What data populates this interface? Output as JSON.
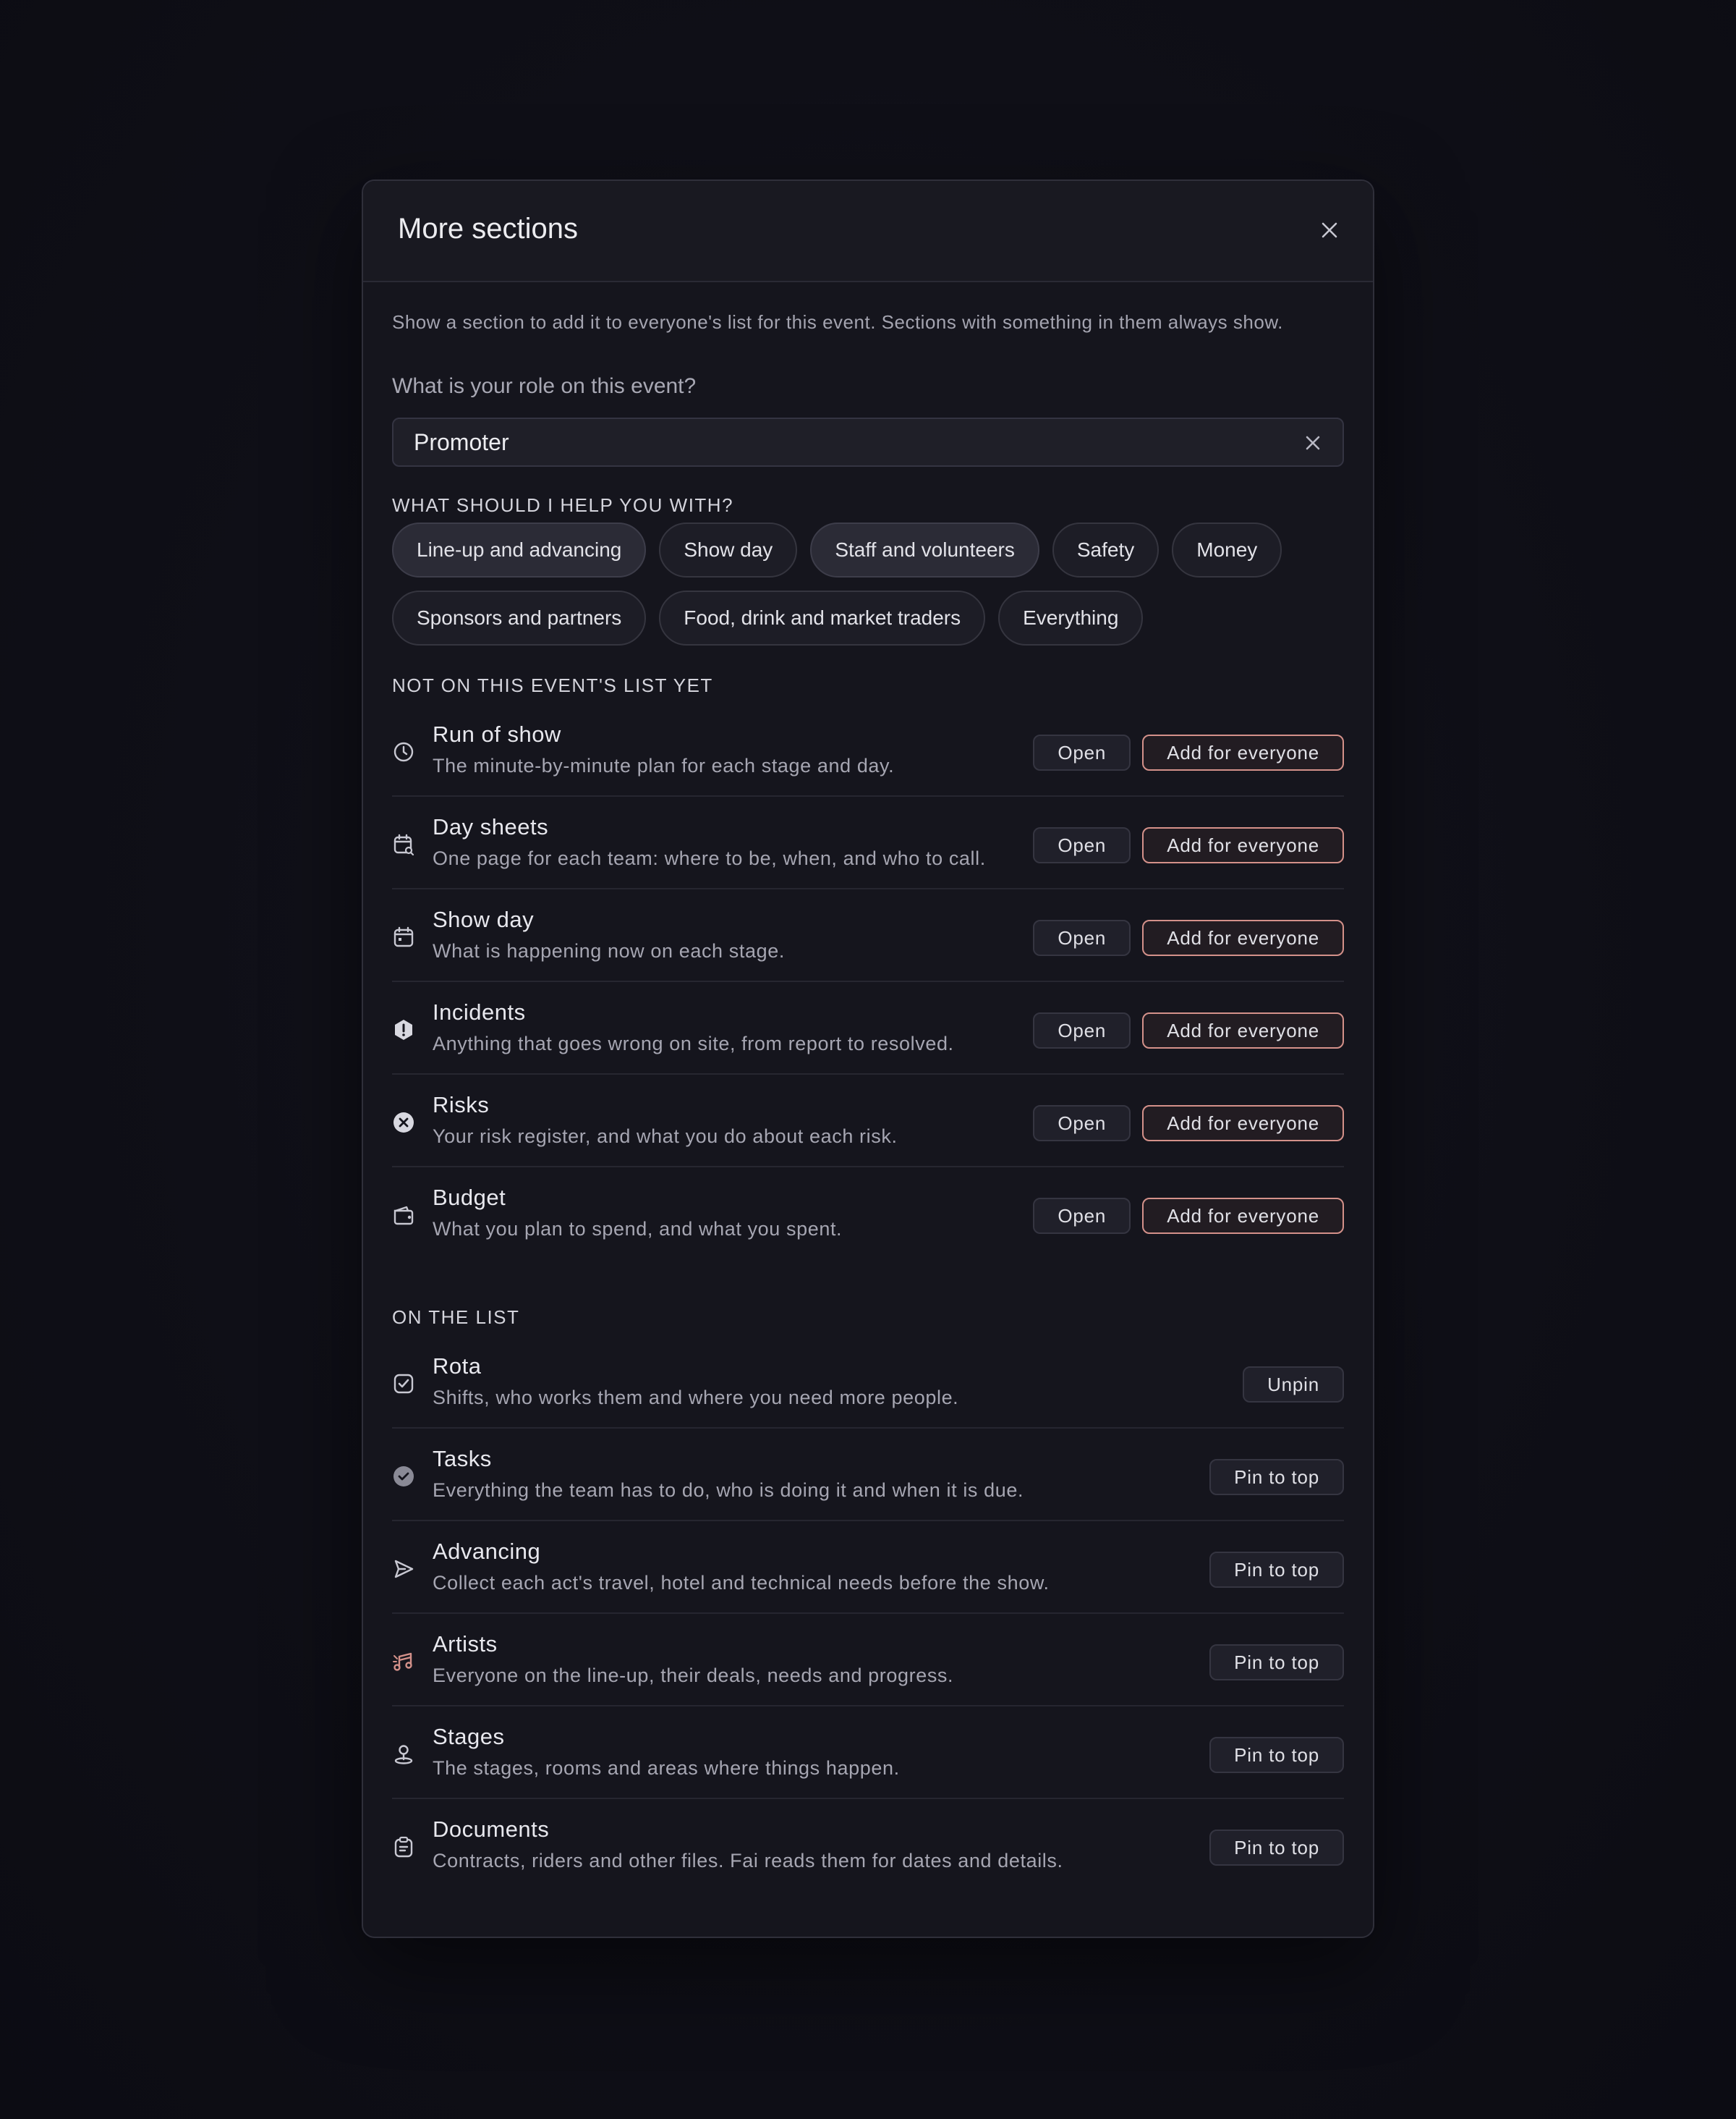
{
  "modal": {
    "title": "More sections",
    "intro": "Show a section to add it to everyone's list for this event. Sections with something in them always show."
  },
  "role": {
    "label": "What is your role on this event?",
    "value": "Promoter"
  },
  "help": {
    "heading": "WHAT SHOULD I HELP YOU WITH?",
    "chips": [
      {
        "label": "Line-up and advancing",
        "selected": true
      },
      {
        "label": "Show day",
        "selected": false
      },
      {
        "label": "Staff and volunteers",
        "selected": true
      },
      {
        "label": "Safety",
        "selected": false
      },
      {
        "label": "Money",
        "selected": false
      },
      {
        "label": "Sponsors and partners",
        "selected": false
      },
      {
        "label": "Food, drink and market traders",
        "selected": false
      },
      {
        "label": "Everything",
        "selected": false
      }
    ]
  },
  "not_on_list": {
    "heading": "NOT ON THIS EVENT'S LIST YET",
    "open_label": "Open",
    "add_label": "Add for everyone",
    "items": [
      {
        "icon": "clock-icon",
        "title": "Run of show",
        "desc": "The minute-by-minute plan for each stage and day."
      },
      {
        "icon": "calendar-search-icon",
        "title": "Day sheets",
        "desc": "One page for each team: where to be, when, and who to call."
      },
      {
        "icon": "calendar-icon",
        "title": "Show day",
        "desc": "What is happening now on each stage."
      },
      {
        "icon": "alert-hexagon-icon",
        "title": "Incidents",
        "desc": "Anything that goes wrong on site, from report to resolved."
      },
      {
        "icon": "x-circle-icon",
        "title": "Risks",
        "desc": "Your risk register, and what you do about each risk."
      },
      {
        "icon": "wallet-icon",
        "title": "Budget",
        "desc": "What you plan to spend, and what you spent."
      }
    ]
  },
  "on_list": {
    "heading": "ON THE LIST",
    "items": [
      {
        "icon": "checkbox-icon",
        "title": "Rota",
        "desc": "Shifts, who works them and where you need more people.",
        "action": "Unpin"
      },
      {
        "icon": "check-circle-icon",
        "title": "Tasks",
        "desc": "Everything the team has to do, who is doing it and when it is due.",
        "action": "Pin to top"
      },
      {
        "icon": "send-icon",
        "title": "Advancing",
        "desc": "Collect each act's travel, hotel and technical needs before the show.",
        "action": "Pin to top"
      },
      {
        "icon": "music-icon",
        "title": "Artists",
        "desc": "Everyone on the line-up, their deals, needs and progress.",
        "action": "Pin to top"
      },
      {
        "icon": "map-pin-icon",
        "title": "Stages",
        "desc": "The stages, rooms and areas where things happen.",
        "action": "Pin to top"
      },
      {
        "icon": "clipboard-icon",
        "title": "Documents",
        "desc": "Contracts, riders and other files. Fai reads them for dates and details.",
        "action": "Pin to top"
      }
    ]
  },
  "colors": {
    "accent": "#d4918a",
    "background": "#0f0f17",
    "panel": "#15151d"
  }
}
